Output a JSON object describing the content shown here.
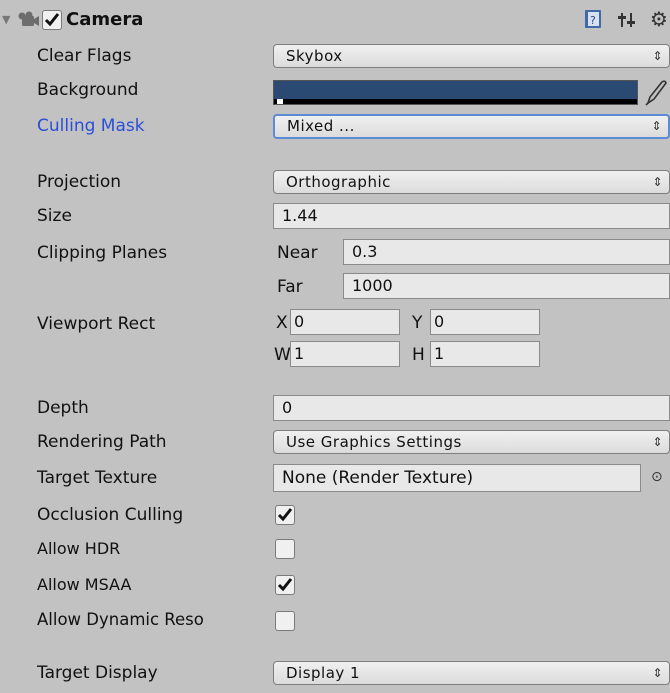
{
  "header": {
    "title": "Camera",
    "enabled": true
  },
  "labels": {
    "clear_flags": "Clear Flags",
    "background": "Background",
    "culling_mask": "Culling Mask",
    "projection": "Projection",
    "size": "Size",
    "clipping_planes": "Clipping Planes",
    "viewport_rect": "Viewport Rect",
    "depth": "Depth",
    "rendering_path": "Rendering Path",
    "target_texture": "Target Texture",
    "occlusion_culling": "Occlusion Culling",
    "allow_hdr": "Allow HDR",
    "allow_msaa": "Allow MSAA",
    "allow_dynamic": "Allow Dynamic Reso",
    "target_display": "Target Display"
  },
  "values": {
    "clear_flags": "Skybox",
    "background_color": "#2b4a73",
    "culling_mask": "Mixed ...",
    "projection": "Orthographic",
    "size": "1.44",
    "near_label": "Near",
    "near": "0.3",
    "far_label": "Far",
    "far": "1000",
    "x_label": "X",
    "x": "0",
    "y_label": "Y",
    "y": "0",
    "w_label": "W",
    "w": "1",
    "h_label": "H",
    "h": "1",
    "depth": "0",
    "rendering_path": "Use Graphics Settings",
    "target_texture": "None (Render Texture)",
    "occlusion_culling": true,
    "allow_hdr": false,
    "allow_msaa": true,
    "allow_dynamic": false,
    "target_display": "Display 1"
  },
  "icons": {
    "foldout": "triangle-down",
    "component": "camera-icon",
    "help": "book-icon",
    "presets": "sliders-icon",
    "settings": "gear-icon",
    "picker": "eyedropper-icon",
    "object_picker": "circle-target-icon"
  }
}
